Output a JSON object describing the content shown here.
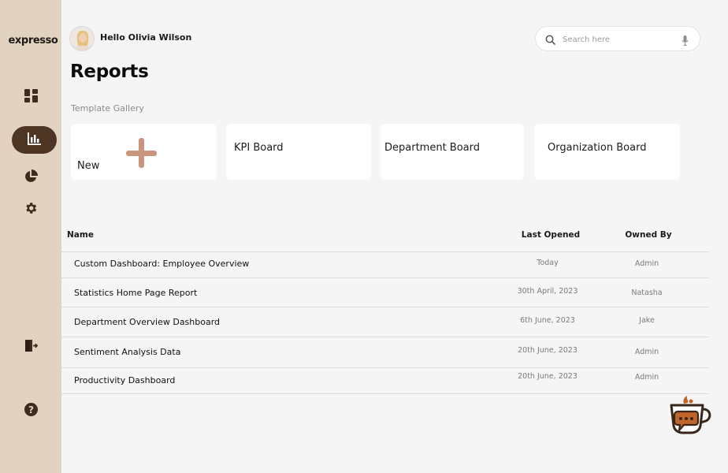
{
  "app": {
    "logo": "expresso"
  },
  "header": {
    "greeting": "Hello Olivia Wilson",
    "search": {
      "placeholder": "Search here",
      "value": ""
    }
  },
  "page": {
    "title": "Reports"
  },
  "gallery": {
    "label": "Template Gallery",
    "cards": [
      {
        "label": "New",
        "icon": "plus-icon"
      },
      {
        "label": "KPI Board"
      },
      {
        "label": "Department Board"
      },
      {
        "label": "Organization Board"
      }
    ]
  },
  "table": {
    "headers": {
      "name": "Name",
      "last_opened": "Last Opened",
      "owned_by": "Owned By"
    },
    "rows": [
      {
        "name": "Custom Dashboard: Employee Overview",
        "last_opened": "Today",
        "owned_by": "Admin"
      },
      {
        "name": "Statistics Home Page Report",
        "last_opened": "30th April, 2023",
        "owned_by": "Natasha"
      },
      {
        "name": "Department Overview Dashboard",
        "last_opened": "6th June, 2023",
        "owned_by": "Jake"
      },
      {
        "name": "Sentiment Analysis Data",
        "last_opened": "20th June, 2023",
        "owned_by": "Admin"
      },
      {
        "name": "Productivity Dashboard",
        "last_opened": "20th June, 2023",
        "owned_by": "Admin"
      }
    ]
  },
  "sidebar": {
    "items": [
      {
        "icon": "dashboard-grid-icon",
        "active": false
      },
      {
        "icon": "bar-chart-icon",
        "active": true
      },
      {
        "icon": "pie-chart-icon",
        "active": false
      },
      {
        "icon": "gear-icon",
        "active": false
      },
      {
        "icon": "logout-icon",
        "active": false
      },
      {
        "icon": "help-icon",
        "active": false
      }
    ]
  },
  "colors": {
    "sidebar": "#e2d3c0",
    "accent": "#4d3524",
    "plus": "#c9957c",
    "background": "#f5f5f5",
    "chat_orange": "#c0652b"
  }
}
